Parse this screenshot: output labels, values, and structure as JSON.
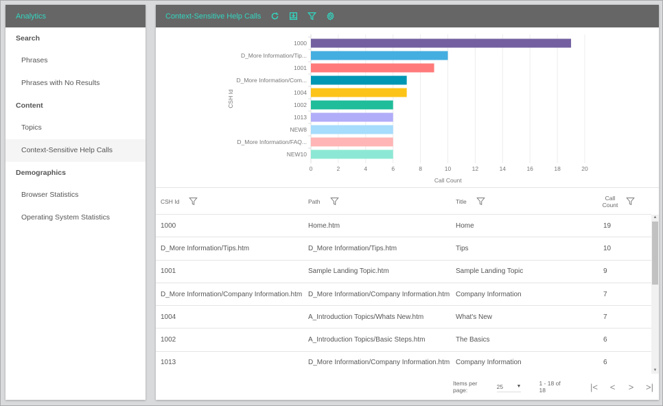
{
  "sidebar": {
    "title": "Analytics",
    "sections": [
      {
        "label": "Search",
        "items": [
          {
            "label": "Phrases"
          },
          {
            "label": "Phrases with No Results"
          }
        ]
      },
      {
        "label": "Content",
        "items": [
          {
            "label": "Topics"
          },
          {
            "label": "Context-Sensitive Help Calls"
          }
        ]
      },
      {
        "label": "Demographics",
        "items": [
          {
            "label": "Browser Statistics"
          },
          {
            "label": "Operating System Statistics"
          }
        ]
      }
    ],
    "active_item": "Context-Sensitive Help Calls"
  },
  "header": {
    "title": "Context-Sensitive Help Calls",
    "icons": [
      "refresh-icon",
      "download-icon",
      "filter-icon",
      "gear-icon"
    ],
    "accent_color": "#33d6c0",
    "background_color": "#666666"
  },
  "chart_data": {
    "type": "bar",
    "orientation": "horizontal",
    "categories": [
      "1000",
      "D_More Information/Tip...",
      "1001",
      "D_More Information/Com...",
      "1004",
      "1002",
      "1013",
      "NEW8",
      "D_More Information/FAQ...",
      "NEW10"
    ],
    "values": [
      19,
      10,
      9,
      7,
      7,
      6,
      6,
      6,
      6,
      6
    ],
    "colors": [
      "#7460a0",
      "#45aee0",
      "#ff7b7b",
      "#0097b4",
      "#fcc419",
      "#1fbd99",
      "#b2adf9",
      "#a6dcfc",
      "#ffb5b5",
      "#8ce8d4"
    ],
    "title": "",
    "xlabel": "Call Count",
    "ylabel": "CSH Id",
    "xlim": [
      0,
      20
    ],
    "xticks": [
      0,
      2,
      4,
      6,
      8,
      10,
      12,
      14,
      16,
      18,
      20
    ],
    "grid": true,
    "legend": "none"
  },
  "table": {
    "columns": [
      {
        "label": "CSH Id"
      },
      {
        "label": "Path"
      },
      {
        "label": "Title"
      },
      {
        "label_line1": "Call",
        "label_line2": "Count"
      }
    ],
    "rows": [
      [
        "1000",
        "Home.htm",
        "Home",
        "19"
      ],
      [
        "D_More Information/Tips.htm",
        "D_More Information/Tips.htm",
        "Tips",
        "10"
      ],
      [
        "1001",
        "Sample Landing Topic.htm",
        "Sample Landing Topic",
        "9"
      ],
      [
        "D_More Information/Company Information.htm",
        "D_More Information/Company Information.htm",
        "Company Information",
        "7"
      ],
      [
        "1004",
        "A_Introduction Topics/Whats New.htm",
        "What's New",
        "7"
      ],
      [
        "1002",
        "A_Introduction Topics/Basic Steps.htm",
        "The Basics",
        "6"
      ],
      [
        "1013",
        "D_More Information/Company Information.htm",
        "Company Information",
        "6"
      ]
    ]
  },
  "paginator": {
    "items_per_page_label": "Items per page:",
    "items_per_page": "25",
    "range": "1 - 18 of 18",
    "first": "|<",
    "prev": "<",
    "next": ">",
    "last": ">|"
  }
}
